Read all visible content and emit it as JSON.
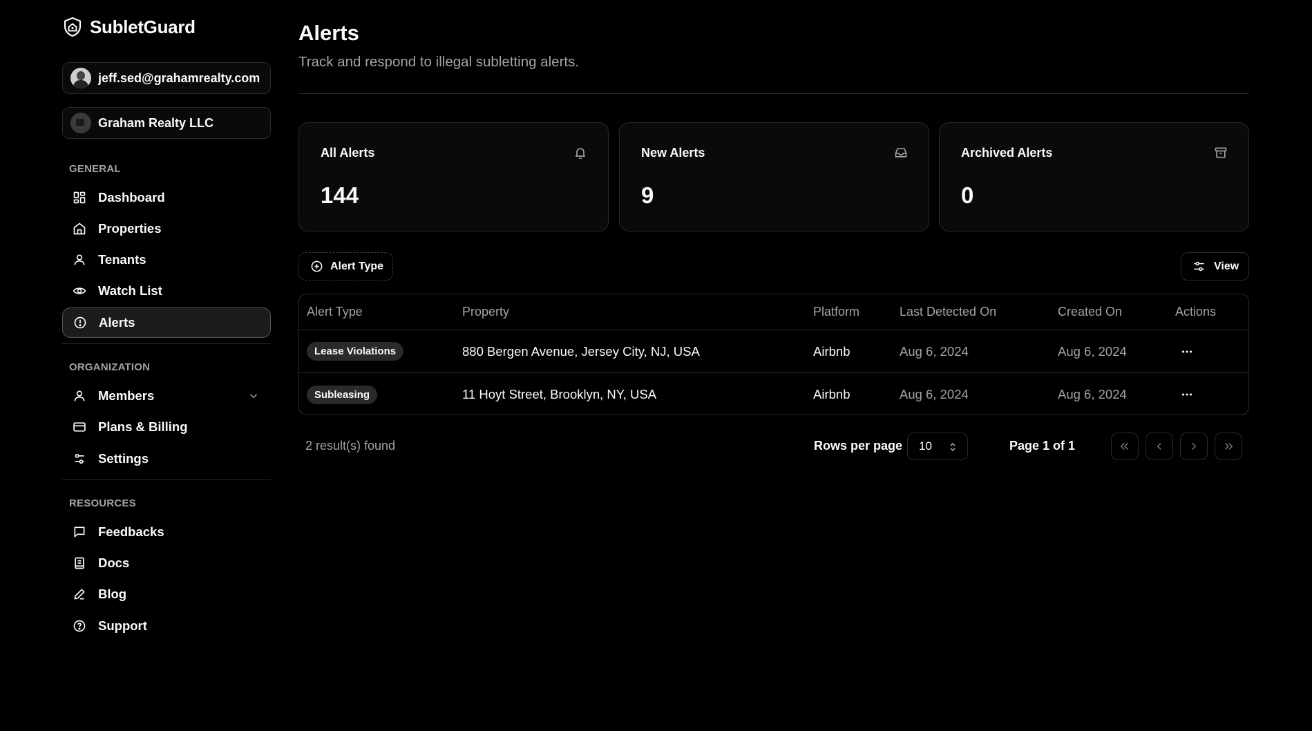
{
  "brand": {
    "name": "SubletGuard"
  },
  "account": {
    "email": "jeff.sed@grahamrealty.com",
    "org": "Graham Realty LLC"
  },
  "sidebar": {
    "general_label": "GENERAL",
    "general": [
      {
        "label": "Dashboard",
        "icon": "dashboard-icon"
      },
      {
        "label": "Properties",
        "icon": "home-icon"
      },
      {
        "label": "Tenants",
        "icon": "user-icon"
      },
      {
        "label": "Watch List",
        "icon": "eye-icon"
      },
      {
        "label": "Alerts",
        "icon": "alert-circle-icon",
        "active": true
      }
    ],
    "organization_label": "ORGANIZATION",
    "organization": [
      {
        "label": "Members",
        "icon": "user-icon"
      },
      {
        "label": "Plans & Billing",
        "icon": "credit-card-icon"
      },
      {
        "label": "Settings",
        "icon": "sliders-icon"
      }
    ],
    "resources_label": "RESOURCES",
    "resources": [
      {
        "label": "Feedbacks",
        "icon": "message-icon"
      },
      {
        "label": "Docs",
        "icon": "book-icon"
      },
      {
        "label": "Blog",
        "icon": "pen-icon"
      },
      {
        "label": "Support",
        "icon": "help-circle-icon"
      }
    ]
  },
  "header": {
    "title": "Alerts",
    "subtitle": "Track and respond to illegal subletting alerts."
  },
  "stats": [
    {
      "label": "All Alerts",
      "value": "144",
      "icon": "bell-icon"
    },
    {
      "label": "New Alerts",
      "value": "9",
      "icon": "inbox-icon"
    },
    {
      "label": "Archived Alerts",
      "value": "0",
      "icon": "archive-icon"
    }
  ],
  "toolbar": {
    "filter_label": "Alert Type",
    "view_label": "View"
  },
  "table": {
    "columns": [
      "Alert Type",
      "Property",
      "Platform",
      "Last Detected On",
      "Created On",
      "Actions"
    ],
    "rows": [
      {
        "type": "Lease Violations",
        "property": "880 Bergen Avenue, Jersey City, NJ, USA",
        "platform": "Airbnb",
        "last_detected": "Aug 6, 2024",
        "created": "Aug 6, 2024"
      },
      {
        "type": "Subleasing",
        "property": "11 Hoyt Street, Brooklyn, NY, USA",
        "platform": "Airbnb",
        "last_detected": "Aug 6, 2024",
        "created": "Aug 6, 2024"
      }
    ]
  },
  "pagination": {
    "results": "2 result(s) found",
    "rows_per_page_label": "Rows per page",
    "rows_per_page": "10",
    "page_info": "Page 1 of 1"
  }
}
